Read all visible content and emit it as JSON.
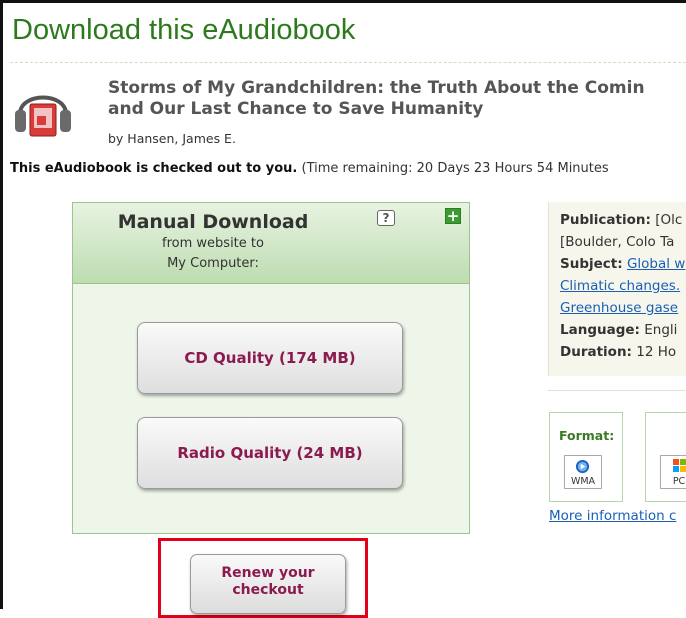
{
  "page": {
    "title": "Download this eAudiobook"
  },
  "book": {
    "title_line1": "Storms of My Grandchildren: the Truth About the Comin",
    "title_line2": "and Our Last Chance to Save Humanity",
    "author": "by Hansen, James E.",
    "icon": "audiobook-headphones-icon"
  },
  "checkout": {
    "status": "This eAudiobook is checked out to you.",
    "remaining": " (Time remaining: 20 Days 23 Hours 54 Minutes"
  },
  "manual_download": {
    "title": "Manual Download",
    "subtitle1": "from website to",
    "subtitle2": "My Computer:",
    "help_icon": "?",
    "expand_icon": "+",
    "cd_quality_label": "CD Quality (174 MB)",
    "radio_quality_label": "Radio Quality (24 MB)"
  },
  "renew": {
    "label_line1": "Renew your",
    "label_line2": "checkout"
  },
  "details": {
    "publication_label": "Publication:",
    "publication_value": " [Olc",
    "publication_cont": "[Boulder, Colo Ta",
    "subject_label": "Subject:",
    "subject_links": [
      "Global w",
      "Climatic changes.",
      "Greenhouse gase"
    ],
    "language_label": "Language:",
    "language_value": " Engli",
    "duration_label": "Duration:",
    "duration_value": " 12 Ho"
  },
  "format": {
    "label": "Format:",
    "wma_label": "WMA",
    "pc_label": "PC",
    "more_info": "More information c"
  },
  "colors": {
    "title_green": "#2d7a1d",
    "button_text": "#8a1a4f",
    "highlight_red": "#e2001a",
    "link_blue": "#1a5fb4"
  }
}
